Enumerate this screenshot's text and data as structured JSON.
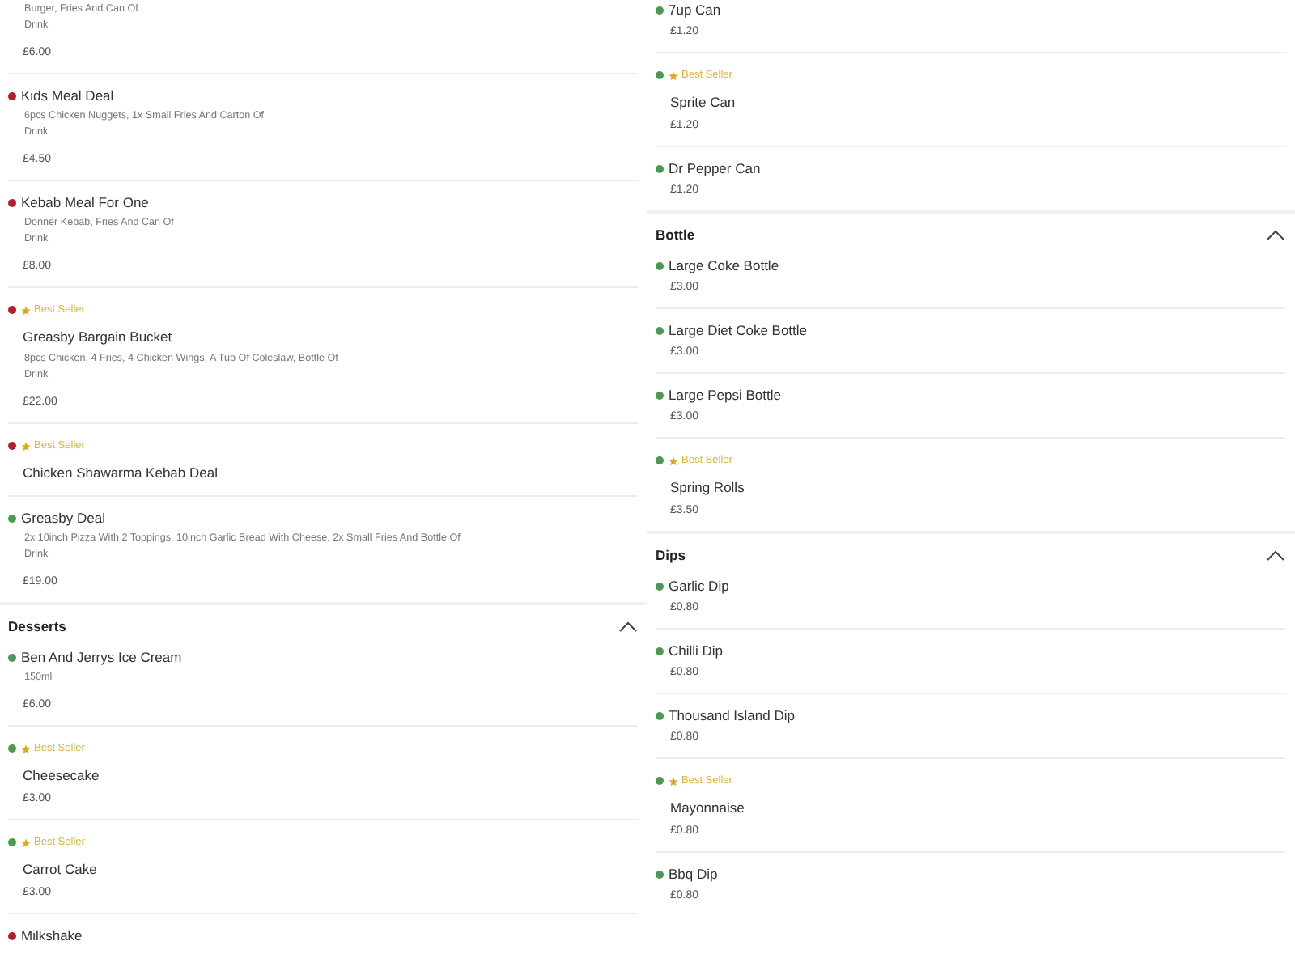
{
  "columns": [
    {
      "sections": [
        {
          "items": [
            {
              "description": "Burger, Fries And Can Of\nDrink",
              "price": "£6.00"
            },
            {
              "name": "Kids Meal Deal",
              "color": "#b3202a",
              "description": "6pcs Chicken Nuggets, 1x Small Fries And Carton Of\nDrink",
              "price": "£4.50"
            },
            {
              "name": "Kebab Meal For One",
              "color": "#b3202a",
              "description": "Donner Kebab, Fries And Can Of\nDrink",
              "price": "£8.00"
            },
            {
              "name": "Greasby Bargain Bucket",
              "color": "#b3202a",
              "badge": "Best Seller",
              "description": "8pcs Chicken, 4 Fries, 4 Chicken Wings, A Tub Of Coleslaw, Bottle Of\nDrink",
              "price": "£22.00"
            },
            {
              "name": "Chicken Shawarma Kebab Deal",
              "color": "#b3202a",
              "badge": "Best Seller"
            },
            {
              "name": "Greasby Deal",
              "color": "#4a9a52",
              "description": "2x 10inch Pizza With 2 Toppings, 10inch Garlic Bread With Cheese, 2x Small Fries And Bottle Of\nDrink",
              "price": "£19.00"
            }
          ]
        },
        {
          "heading": "Desserts",
          "expanded": true,
          "items": [
            {
              "name": "Ben And Jerrys Ice Cream",
              "color": "#4a9a52",
              "description": "150ml",
              "price": "£6.00"
            },
            {
              "name": "Cheesecake",
              "color": "#4a9a52",
              "badge": "Best Seller",
              "price": "£3.00"
            },
            {
              "name": "Carrot Cake",
              "color": "#4a9a52",
              "badge": "Best Seller",
              "price": "£3.00"
            },
            {
              "name": "Milkshake",
              "color": "#b3202a"
            }
          ]
        }
      ]
    },
    {
      "sections": [
        {
          "items": [
            {
              "name": "7up Can",
              "color": "#4a9a52",
              "price": "£1.20"
            },
            {
              "name": "Sprite Can",
              "color": "#4a9a52",
              "badge": "Best Seller",
              "price": "£1.20"
            },
            {
              "name": "Dr Pepper Can",
              "color": "#4a9a52",
              "price": "£1.20"
            }
          ]
        },
        {
          "heading": "Bottle",
          "expanded": true,
          "items": [
            {
              "name": "Large Coke Bottle",
              "color": "#4a9a52",
              "price": "£3.00"
            },
            {
              "name": "Large Diet Coke Bottle",
              "color": "#4a9a52",
              "price": "£3.00"
            },
            {
              "name": "Large Pepsi Bottle",
              "color": "#4a9a52",
              "price": "£3.00"
            },
            {
              "name": "Spring Rolls",
              "color": "#4a9a52",
              "badge": "Best Seller",
              "price": "£3.50"
            }
          ]
        },
        {
          "heading": "Dips",
          "expanded": true,
          "items": [
            {
              "name": "Garlic Dip",
              "color": "#4a9a52",
              "price": "£0.80"
            },
            {
              "name": "Chilli Dip",
              "color": "#4a9a52",
              "price": "£0.80"
            },
            {
              "name": "Thousand Island Dip",
              "color": "#4a9a52",
              "price": "£0.80"
            },
            {
              "name": "Mayonnaise",
              "color": "#4a9a52",
              "badge": "Best Seller",
              "price": "£0.80"
            },
            {
              "name": "Bbq Dip",
              "color": "#4a9a52",
              "price": "£0.80"
            }
          ]
        }
      ]
    }
  ]
}
